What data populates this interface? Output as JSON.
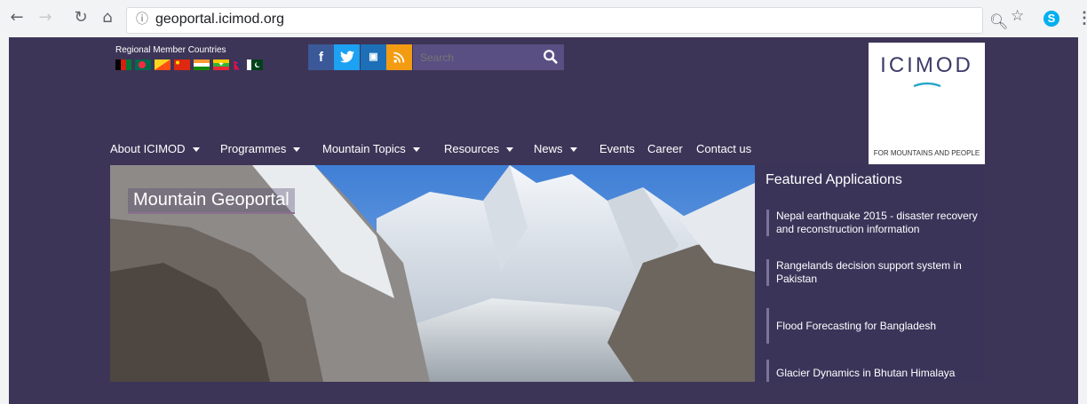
{
  "browser": {
    "url": "geoportal.icimod.org",
    "icons": [
      "back-icon",
      "forward-icon",
      "reload-icon",
      "home-icon",
      "info-icon",
      "zoom-icon",
      "star-icon",
      "skype-icon",
      "menu-icon"
    ]
  },
  "header": {
    "rmc_label": "Regional Member Countries",
    "flags": [
      "Afghanistan",
      "Bangladesh",
      "Bhutan",
      "China",
      "India",
      "Myanmar",
      "Nepal",
      "Pakistan"
    ],
    "social": [
      "facebook",
      "twitter",
      "youtube",
      "rss"
    ],
    "search_placeholder": "Search",
    "logo": {
      "text": "ICIMOD",
      "tagline": "FOR MOUNTAINS AND PEOPLE"
    }
  },
  "nav": {
    "items": [
      {
        "label": "About ICIMOD",
        "dropdown": true
      },
      {
        "label": "Programmes",
        "dropdown": true
      },
      {
        "label": "Mountain Topics",
        "dropdown": true
      },
      {
        "label": "Resources",
        "dropdown": true
      },
      {
        "label": "News",
        "dropdown": true
      },
      {
        "label": "Events",
        "dropdown": false
      },
      {
        "label": "Career",
        "dropdown": false
      },
      {
        "label": "Contact us",
        "dropdown": false
      }
    ]
  },
  "hero": {
    "title": "Mountain Geoportal"
  },
  "featured": {
    "title": "Featured Applications",
    "items": [
      "Nepal earthquake 2015 - disaster recovery and reconstruction information",
      "Rangelands decision support system in Pakistan",
      "Flood Forecasting for Bangladesh",
      "Glacier Dynamics in Bhutan Himalaya"
    ]
  },
  "colors": {
    "page_bg": "#3d3557",
    "facebook": "#3b5998",
    "twitter": "#1da1f2",
    "youtube": "#1d6fb8",
    "rss": "#f39c12",
    "logo_text": "#3d3a68"
  }
}
